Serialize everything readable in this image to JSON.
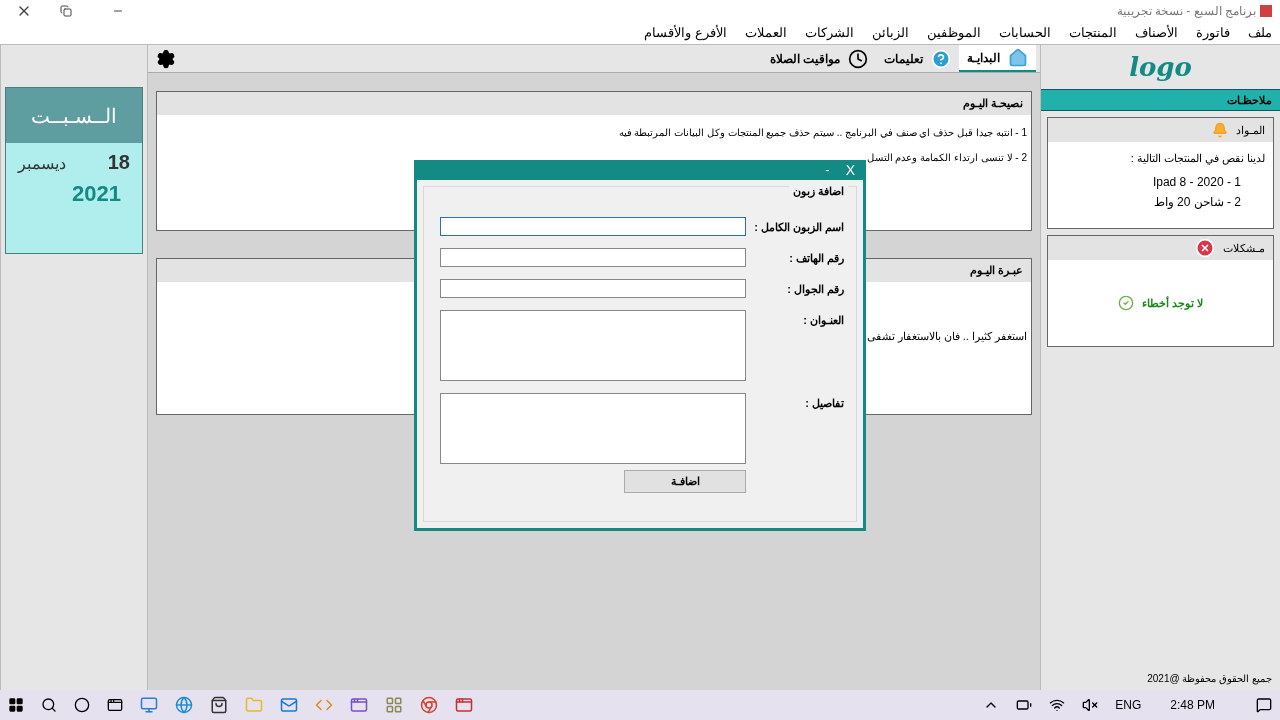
{
  "window": {
    "title": "برنامج السبع - نسخة تجريبية"
  },
  "menu": [
    "ملف",
    "فاتورة",
    "الأصناف",
    "المنتجات",
    "الحسابات",
    "الموظفين",
    "الزبائن",
    "الشركات",
    "العملات",
    "الأفرع والأقسام"
  ],
  "tabs": [
    {
      "label": "البدايـة",
      "selected": true,
      "kind": "home"
    },
    {
      "label": "تعليمات",
      "selected": false,
      "kind": "help"
    },
    {
      "label": "مواقيت الصلاة",
      "selected": false,
      "kind": "clock"
    }
  ],
  "calendar": {
    "day_name": "الــسـبــت",
    "day": "18",
    "month": "ديسمبر",
    "year": "2021"
  },
  "tip_panel": {
    "title": "نصيحـة اليـوم",
    "lines": [
      "1 - انتبه جيدا قبل حذف اي صنف في البرنامج .. سيتم حذف جميع المنتجات وكل البيانات المرتبطة فيه",
      "2 - لا تنسى ارتداء الكمامة وعدم التسل"
    ]
  },
  "quote_panel": {
    "title": "عبـرة اليـوم",
    "text": "استغفر كثيرا .. فان بالاستغفار تشفى"
  },
  "logo": "logo",
  "notes": {
    "title": "ملاحظـات",
    "materials": {
      "title": "المـواد",
      "intro": "لدينا نقص في المنتجات التالية :",
      "items": [
        "1 - 2020 - Ipad 8",
        "2 - شاحن 20 واط"
      ]
    },
    "problems": {
      "title": "مـشكلات",
      "message": "لا توجد أخطاء"
    }
  },
  "footer": "جميع الحقوق محفوظة @2021",
  "dialog": {
    "minimize": "-",
    "close": "X",
    "group_title": "اضافة زبون",
    "fields": [
      {
        "label": "اسم الزبون الكامل :",
        "kind": "line",
        "focused": true
      },
      {
        "label": "رقم الهاتف :",
        "kind": "line",
        "focused": false
      },
      {
        "label": "رقم الجوال :",
        "kind": "line",
        "focused": false
      },
      {
        "label": "العنـوان :",
        "kind": "area",
        "focused": false
      },
      {
        "label": "تفاصيل :",
        "kind": "area",
        "focused": false
      }
    ],
    "button": "اضافـة"
  },
  "taskbar": {
    "language": "ENG",
    "time": "2:48 PM"
  }
}
